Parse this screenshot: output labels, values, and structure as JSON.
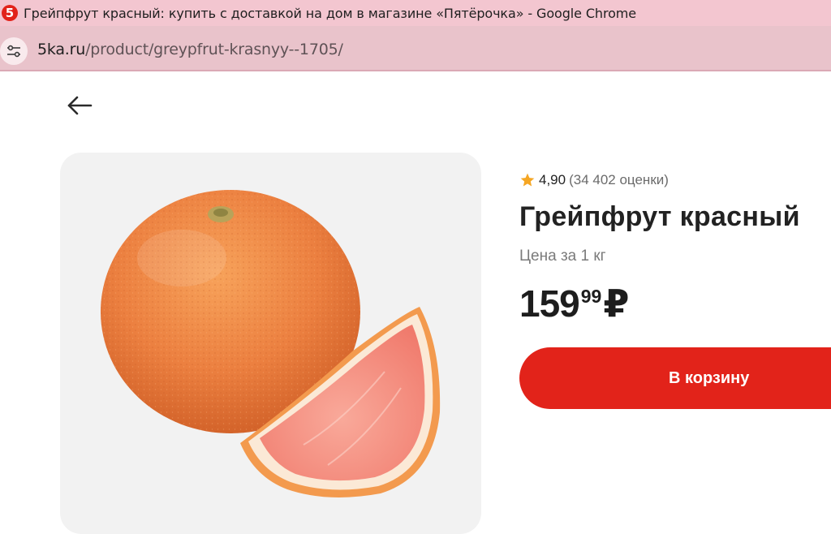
{
  "browser": {
    "window_title": "Грейпфрут красный: купить с доставкой на дом в магазине «Пятёрочка» - Google Chrome",
    "favicon_text": "5",
    "url_host": "5ka.ru",
    "url_path": "/product/greypfrut-krasnyy--1705/"
  },
  "product": {
    "rating_value": "4,90",
    "rating_count": "(34 402 оценки)",
    "title": "Грейпфрут красный",
    "unit_label": "Цена за 1 кг",
    "price_rub": "159",
    "price_kop": "99",
    "currency": "₽",
    "add_to_cart_label": "В корзину"
  },
  "colors": {
    "accent": "#e2231a",
    "star": "#f5a623",
    "titlebar": "#f3c6d0",
    "addressbar": "#e9c3cb"
  },
  "icons": {
    "back": "arrow-left-icon",
    "site_info": "tune-icon",
    "rating": "star-icon"
  }
}
